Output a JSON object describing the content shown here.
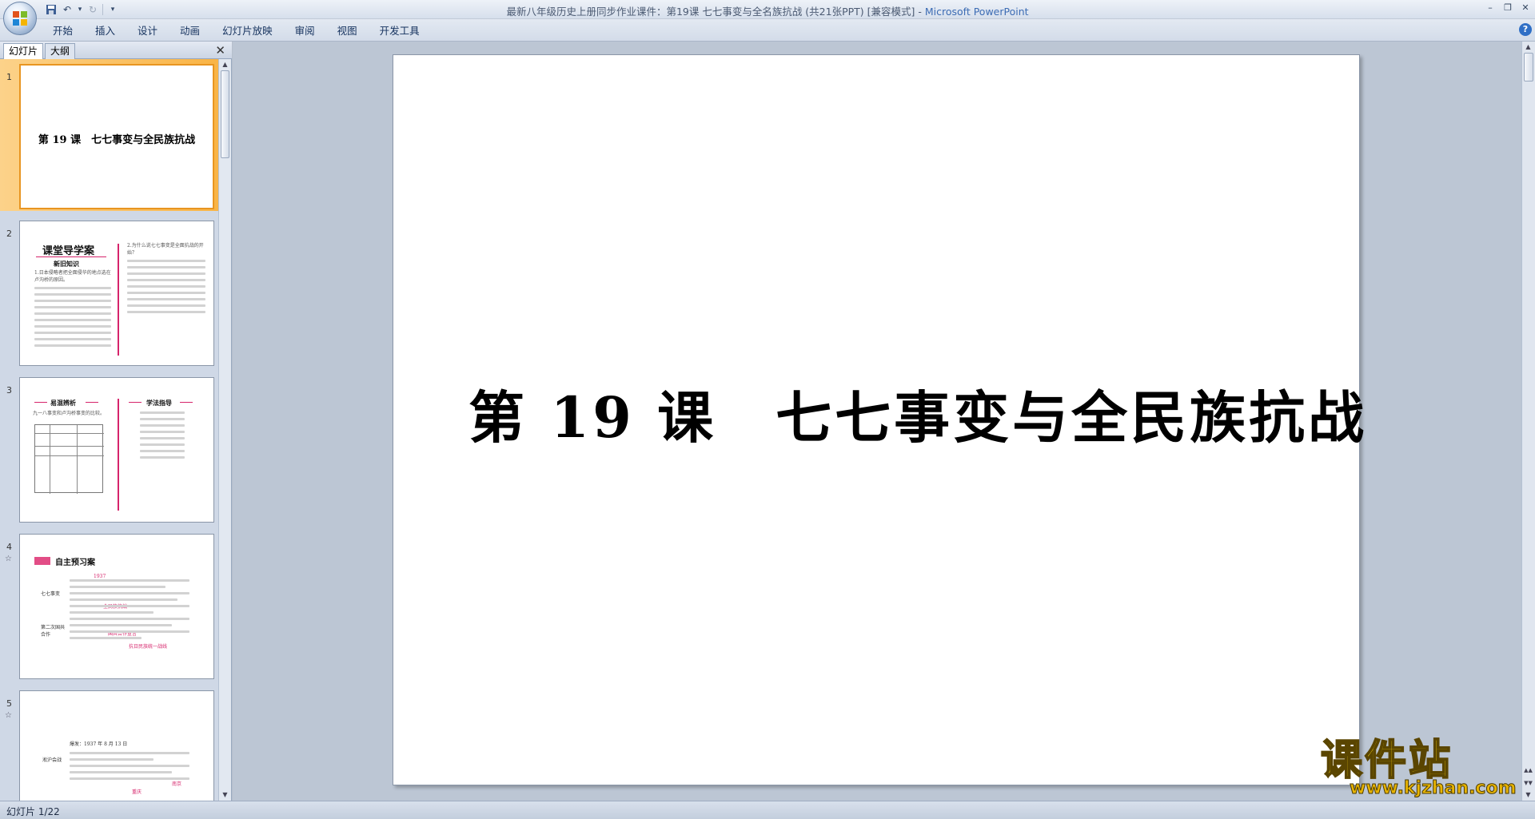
{
  "window": {
    "title_prefix": "最新八年级历史上册同步作业课件：第19课 七七事变与全名族抗战 (共21张PPT) [兼容模式] - ",
    "app_name": "Microsoft PowerPoint"
  },
  "ribbon": {
    "tabs": [
      "开始",
      "插入",
      "设计",
      "动画",
      "幻灯片放映",
      "审阅",
      "视图",
      "开发工具"
    ]
  },
  "panel": {
    "tab_slides": "幻灯片",
    "tab_outline": "大纲",
    "close_glyph": "✕"
  },
  "thumbnails": [
    {
      "num": "1",
      "title": "第 19 课　七七事变与全民族抗战"
    },
    {
      "num": "2",
      "head": "课堂导学案",
      "sub": "新旧知识",
      "q1": "1.日本侵略者把全面侵华的地点选在卢沟桥的原因。",
      "q2": "2.为什么说七七事变是全面抗战的开始？"
    },
    {
      "num": "3",
      "head_left": "易混辨析",
      "head_right": "学法指导",
      "q": "九一八事变和卢沟桥事变的比较。"
    },
    {
      "num": "4",
      "star": "☆",
      "head": "自主预习案",
      "item1": "七七事变",
      "item2": "第二次国共合作",
      "blank1": "1937",
      "blank2": "全民族抗战",
      "blank3": "国共合作宣言",
      "blank4": "抗日民族统一战线"
    },
    {
      "num": "5",
      "star": "☆",
      "item1": "淞沪会战",
      "line1": "爆发：1937 年 8 月 13 日",
      "blank1": "南京",
      "blank2": "重庆"
    }
  ],
  "slide": {
    "title": "第 19 课　七七事变与全民族抗战"
  },
  "status": {
    "text": "幻灯片 1/22"
  },
  "watermark": {
    "text": "课件站",
    "url": "www.kjzhan.com"
  }
}
